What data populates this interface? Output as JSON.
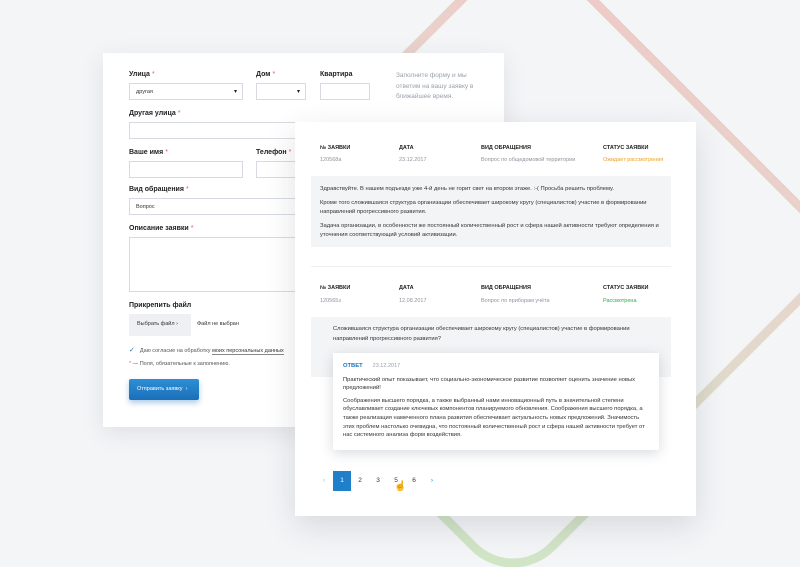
{
  "form": {
    "street_label": "Улица",
    "street_value": "другая",
    "house_label": "Дом",
    "apartment_label": "Квартира",
    "other_street_label": "Другая улица",
    "name_label": "Ваше имя",
    "phone_label": "Телефон",
    "type_label": "Вид обращения",
    "type_value": "Вопрос",
    "description_label": "Описание заявки",
    "attach_label": "Прикрепить файл",
    "choose_file": "Выбрать файл",
    "no_file": "Файл не выбран",
    "consent_text": "Даю согласие на обработку",
    "consent_link": "моих персональных данных",
    "required_note": "— Поля, обязательные к заполнению.",
    "required_mark": "*",
    "submit": "Отправить заявку",
    "hint": "Заполните форму и мы ответим на вашу заявку в ближайшее время."
  },
  "list": {
    "headers": [
      "№ ЗАЯВКИ",
      "ДАТА",
      "ВИД ОБРАЩЕНИЯ",
      "СТАТУС ЗАЯВКИ"
    ],
    "requests": [
      {
        "number": "120568a",
        "date": "23.12.2017",
        "type": "Вопрос по общедомовой территории",
        "status": "Ожидает рассмотрения",
        "message": [
          "Здравствуйте. В нашем подъезде уже 4-й день не горит свет на втором этаже. :-( Просьба решить проблему.",
          "Кроме того сложившаяся структура организации обеспечивает широкому кругу (специалистов) участие в формировании направлений прогрессивного развития.",
          "Задача организации, в особенности же постоянный количественный рост и сфера нашей активности требуют определения и уточнения соответствующий условий активизации."
        ]
      },
      {
        "number": "120565з",
        "date": "12.08.2017",
        "type": "Вопрос по приборам учёта",
        "status": "Рассмотрена",
        "message": [
          "Сложившаяся структура организации обеспечивает широкому кругу (специалистов) участие в формировании направлений прогрессивного развития?"
        ],
        "answer": {
          "tag": "ОТВЕТ",
          "date": "23.12.2017",
          "paragraphs": [
            "Практический опыт показывает, что социально-экономическое развитие позволяет оценить значение новых предложений!",
            "Соображения высшего порядка, а также выбранный нами инновационный путь в значительной степени обуславливает создание ключевых компонентов планируемого обновления. Соображения высшего порядка, а также реализация намеченного плана развития обеспечивает актуальность новых предложений. Значимость этих проблем настолько очевидна, что постоянный количественный рост и сфера нашей активности требует от нас системного анализа форм воздействия."
          ]
        }
      }
    ],
    "pagination": [
      "1",
      "2",
      "3",
      "5",
      "6"
    ],
    "prev_icon": "‹",
    "next_icon": "›"
  },
  "colors": {
    "accent": "#1f7fc8",
    "waiting": "#f0a020",
    "done": "#2fa84f",
    "required": "#e35a5a"
  }
}
